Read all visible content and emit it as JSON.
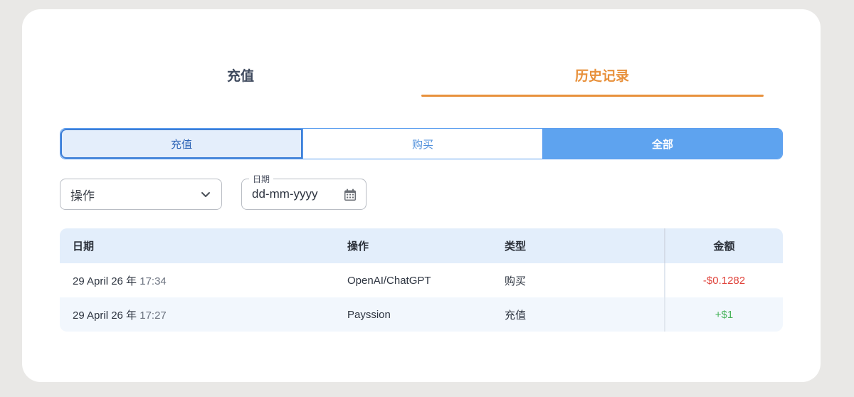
{
  "tabs": [
    {
      "label": "充值",
      "active": false
    },
    {
      "label": "历史记录",
      "active": true
    }
  ],
  "filter_buttons": [
    {
      "label": "充值",
      "selected": false
    },
    {
      "label": "购买",
      "selected": false
    },
    {
      "label": "全部",
      "selected": true
    }
  ],
  "operation_select": {
    "value": "操作",
    "icon": "chevron-down-icon"
  },
  "date_field": {
    "legend": "日期",
    "placeholder": "dd-mm-yyyy",
    "icon": "calendar-icon"
  },
  "table": {
    "headers": {
      "date": "日期",
      "operation": "操作",
      "type": "类型",
      "amount": "金额"
    },
    "rows": [
      {
        "date": "29 April 26 年",
        "time": "17:34",
        "operation": "OpenAI/ChatGPT",
        "type": "购买",
        "amount": "-$0.1282"
      },
      {
        "date": "29 April 26 年",
        "time": "17:27",
        "operation": "Payssion",
        "type": "充值",
        "amount": "+$1"
      }
    ]
  },
  "colors": {
    "accent": "#e8913c",
    "primary": "#5ea3ef",
    "negative": "#e0443c",
    "positive": "#47b35a"
  }
}
